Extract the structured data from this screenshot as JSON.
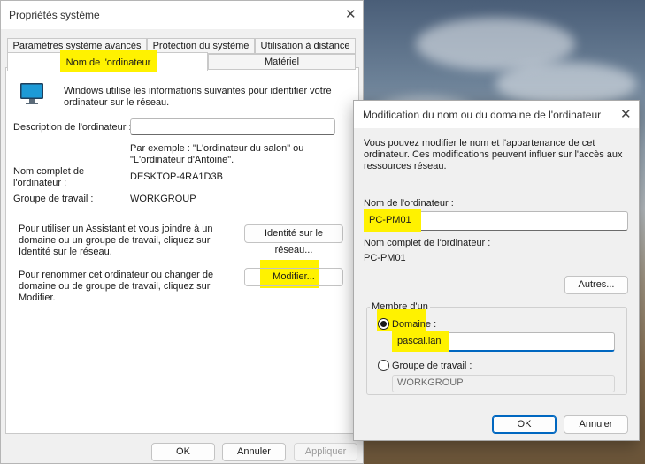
{
  "main_dialog": {
    "title": "Propriétés système",
    "tabs_top": [
      "Paramètres système avancés",
      "Protection du système",
      "Utilisation à distance"
    ],
    "tabs_bottom": [
      "Nom de l'ordinateur",
      "Matériel"
    ],
    "intro": "Windows utilise les informations suivantes pour identifier votre ordinateur sur le réseau.",
    "description_label": "Description de l'ordinateur :",
    "description_value": "",
    "example_text": "Par exemple : \"L'ordinateur du salon\" ou \"L'ordinateur d'Antoine\".",
    "fullname_label": "Nom complet de l'ordinateur :",
    "fullname_value": "DESKTOP-4RA1D3B",
    "workgroup_label": "Groupe de travail :",
    "workgroup_value": "WORKGROUP",
    "assistant_text": "Pour utiliser un Assistant et vous joindre à un domaine ou un groupe de travail, cliquez sur Identité sur le réseau.",
    "network_id_button": "Identité sur le réseau...",
    "rename_text": "Pour renommer cet ordinateur ou changer de domaine ou de groupe de travail, cliquez sur Modifier.",
    "modify_button": "Modifier...",
    "ok_button": "OK",
    "cancel_button": "Annuler",
    "apply_button": "Appliquer"
  },
  "sub_dialog": {
    "title": "Modification du nom ou du domaine de l'ordinateur",
    "intro": "Vous pouvez modifier le nom et l'appartenance de cet ordinateur. Ces modifications peuvent influer sur l'accès aux ressources réseau.",
    "name_label": "Nom de l'ordinateur :",
    "name_value": "PC-PM01",
    "fullname_label": "Nom complet de l'ordinateur :",
    "fullname_value": "PC-PM01",
    "more_button": "Autres...",
    "member_label": "Membre d'un",
    "domain_label": "Domaine :",
    "domain_value": "pascal.lan",
    "workgroup_label": "Groupe de travail :",
    "workgroup_value": "WORKGROUP",
    "ok_button": "OK",
    "cancel_button": "Annuler"
  },
  "colors": {
    "highlight": "#fff200",
    "accent": "#0067c0"
  },
  "icons": {
    "computer": "computer-monitor-icon",
    "close": "close-icon"
  }
}
